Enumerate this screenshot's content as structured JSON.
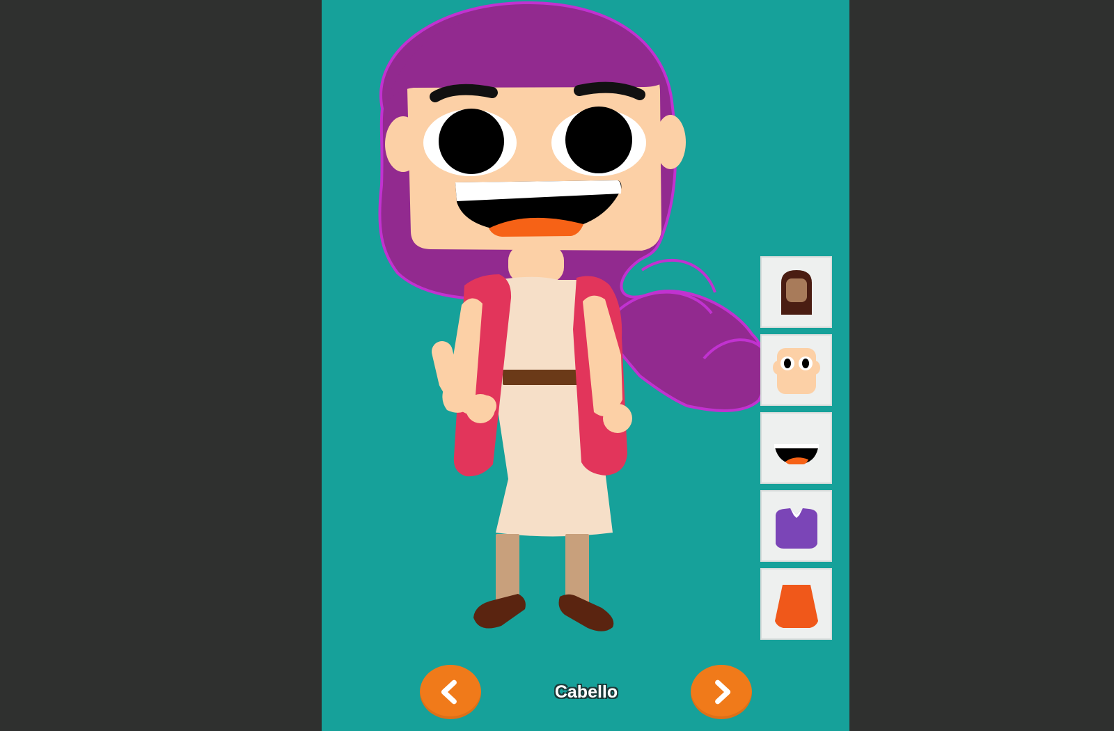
{
  "screen": {
    "background_color": "#2f302f",
    "game_background_color": "#16a19a"
  },
  "character": {
    "hair_color": "#922a8f",
    "hair_outline_color": "#c132d0",
    "skin_color": "#fcd0a6",
    "dress_color": "#f6dfc8",
    "vest_color": "#e2355b",
    "belt_color": "#6b3a18",
    "shoe_color": "#5a2410"
  },
  "parts_menu": {
    "items": [
      {
        "icon": "hair-icon",
        "name": "Cabello"
      },
      {
        "icon": "face-icon",
        "name": ""
      },
      {
        "icon": "mouth-icon",
        "name": ""
      },
      {
        "icon": "shirt-icon",
        "name": ""
      },
      {
        "icon": "skirt-icon",
        "name": ""
      }
    ]
  },
  "navigation": {
    "previous_icon": "chevron-left-icon",
    "next_icon": "chevron-right-icon",
    "current_part_label": "Cabello",
    "button_color": "#f07a1a"
  }
}
